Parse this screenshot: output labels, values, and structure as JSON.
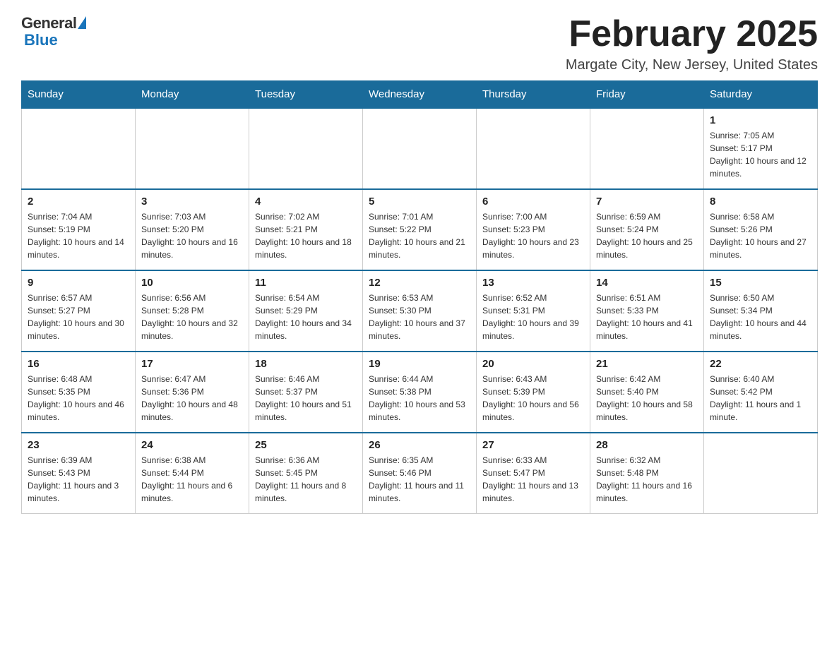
{
  "logo": {
    "general": "General",
    "blue": "Blue"
  },
  "title": "February 2025",
  "location": "Margate City, New Jersey, United States",
  "days_of_week": [
    "Sunday",
    "Monday",
    "Tuesday",
    "Wednesday",
    "Thursday",
    "Friday",
    "Saturday"
  ],
  "weeks": [
    [
      {
        "day": "",
        "info": ""
      },
      {
        "day": "",
        "info": ""
      },
      {
        "day": "",
        "info": ""
      },
      {
        "day": "",
        "info": ""
      },
      {
        "day": "",
        "info": ""
      },
      {
        "day": "",
        "info": ""
      },
      {
        "day": "1",
        "info": "Sunrise: 7:05 AM\nSunset: 5:17 PM\nDaylight: 10 hours and 12 minutes."
      }
    ],
    [
      {
        "day": "2",
        "info": "Sunrise: 7:04 AM\nSunset: 5:19 PM\nDaylight: 10 hours and 14 minutes."
      },
      {
        "day": "3",
        "info": "Sunrise: 7:03 AM\nSunset: 5:20 PM\nDaylight: 10 hours and 16 minutes."
      },
      {
        "day": "4",
        "info": "Sunrise: 7:02 AM\nSunset: 5:21 PM\nDaylight: 10 hours and 18 minutes."
      },
      {
        "day": "5",
        "info": "Sunrise: 7:01 AM\nSunset: 5:22 PM\nDaylight: 10 hours and 21 minutes."
      },
      {
        "day": "6",
        "info": "Sunrise: 7:00 AM\nSunset: 5:23 PM\nDaylight: 10 hours and 23 minutes."
      },
      {
        "day": "7",
        "info": "Sunrise: 6:59 AM\nSunset: 5:24 PM\nDaylight: 10 hours and 25 minutes."
      },
      {
        "day": "8",
        "info": "Sunrise: 6:58 AM\nSunset: 5:26 PM\nDaylight: 10 hours and 27 minutes."
      }
    ],
    [
      {
        "day": "9",
        "info": "Sunrise: 6:57 AM\nSunset: 5:27 PM\nDaylight: 10 hours and 30 minutes."
      },
      {
        "day": "10",
        "info": "Sunrise: 6:56 AM\nSunset: 5:28 PM\nDaylight: 10 hours and 32 minutes."
      },
      {
        "day": "11",
        "info": "Sunrise: 6:54 AM\nSunset: 5:29 PM\nDaylight: 10 hours and 34 minutes."
      },
      {
        "day": "12",
        "info": "Sunrise: 6:53 AM\nSunset: 5:30 PM\nDaylight: 10 hours and 37 minutes."
      },
      {
        "day": "13",
        "info": "Sunrise: 6:52 AM\nSunset: 5:31 PM\nDaylight: 10 hours and 39 minutes."
      },
      {
        "day": "14",
        "info": "Sunrise: 6:51 AM\nSunset: 5:33 PM\nDaylight: 10 hours and 41 minutes."
      },
      {
        "day": "15",
        "info": "Sunrise: 6:50 AM\nSunset: 5:34 PM\nDaylight: 10 hours and 44 minutes."
      }
    ],
    [
      {
        "day": "16",
        "info": "Sunrise: 6:48 AM\nSunset: 5:35 PM\nDaylight: 10 hours and 46 minutes."
      },
      {
        "day": "17",
        "info": "Sunrise: 6:47 AM\nSunset: 5:36 PM\nDaylight: 10 hours and 48 minutes."
      },
      {
        "day": "18",
        "info": "Sunrise: 6:46 AM\nSunset: 5:37 PM\nDaylight: 10 hours and 51 minutes."
      },
      {
        "day": "19",
        "info": "Sunrise: 6:44 AM\nSunset: 5:38 PM\nDaylight: 10 hours and 53 minutes."
      },
      {
        "day": "20",
        "info": "Sunrise: 6:43 AM\nSunset: 5:39 PM\nDaylight: 10 hours and 56 minutes."
      },
      {
        "day": "21",
        "info": "Sunrise: 6:42 AM\nSunset: 5:40 PM\nDaylight: 10 hours and 58 minutes."
      },
      {
        "day": "22",
        "info": "Sunrise: 6:40 AM\nSunset: 5:42 PM\nDaylight: 11 hours and 1 minute."
      }
    ],
    [
      {
        "day": "23",
        "info": "Sunrise: 6:39 AM\nSunset: 5:43 PM\nDaylight: 11 hours and 3 minutes."
      },
      {
        "day": "24",
        "info": "Sunrise: 6:38 AM\nSunset: 5:44 PM\nDaylight: 11 hours and 6 minutes."
      },
      {
        "day": "25",
        "info": "Sunrise: 6:36 AM\nSunset: 5:45 PM\nDaylight: 11 hours and 8 minutes."
      },
      {
        "day": "26",
        "info": "Sunrise: 6:35 AM\nSunset: 5:46 PM\nDaylight: 11 hours and 11 minutes."
      },
      {
        "day": "27",
        "info": "Sunrise: 6:33 AM\nSunset: 5:47 PM\nDaylight: 11 hours and 13 minutes."
      },
      {
        "day": "28",
        "info": "Sunrise: 6:32 AM\nSunset: 5:48 PM\nDaylight: 11 hours and 16 minutes."
      },
      {
        "day": "",
        "info": ""
      }
    ]
  ]
}
